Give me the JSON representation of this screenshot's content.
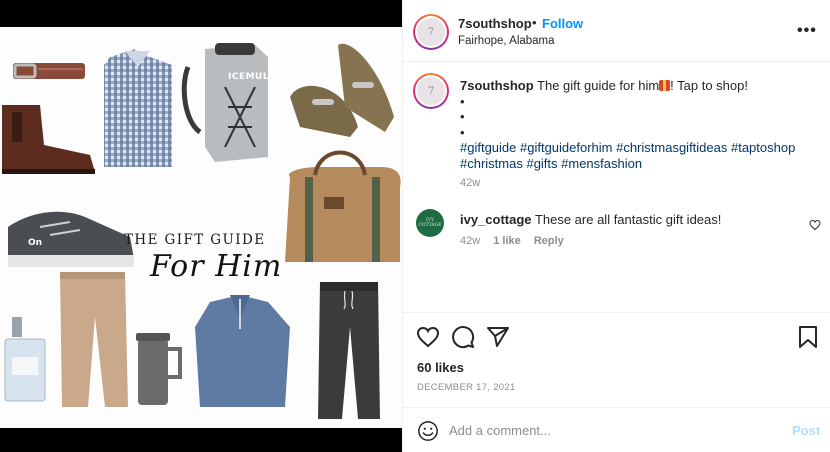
{
  "image": {
    "title_line": "THE GIFT GUIDE",
    "script_line": "For Him",
    "cooler_brand": "ICEMULE",
    "shoe_brand": "On"
  },
  "header": {
    "username": "7southshop",
    "separator": "•",
    "follow_label": "Follow",
    "location": "Fairhope, Alabama",
    "more_icon": "more-horizontal-icon",
    "avatar_text": "7"
  },
  "caption": {
    "username": "7southshop",
    "text_before_emoji": " The gift guide for him",
    "emoji": "gift-emoji",
    "text_after_emoji": "! Tap to shop!",
    "bullets": [
      "•",
      "•",
      "•"
    ],
    "hashtags": "#giftguide #giftguideforhim #christmasgiftideas #taptoshop #christmas #gifts #mensfashion",
    "time": "42w"
  },
  "comment": {
    "username": "ivy_cottage",
    "text": "These are all fantastic gift ideas!",
    "time": "42w",
    "likes": "1 like",
    "reply": "Reply",
    "avatar_text": "IVY COTTAGE"
  },
  "actions": {
    "likes": "60 likes",
    "date": "DECEMBER 17, 2021",
    "icons": [
      "heart-icon",
      "comment-icon",
      "share-icon",
      "bookmark-icon"
    ]
  },
  "comment_box": {
    "placeholder": "Add a comment...",
    "post_label": "Post"
  },
  "colors": {
    "link_blue": "#0095f6",
    "hashtag_blue": "#00376b",
    "muted_gray": "#8e8e8e",
    "post_disabled": "#b2dffc"
  }
}
